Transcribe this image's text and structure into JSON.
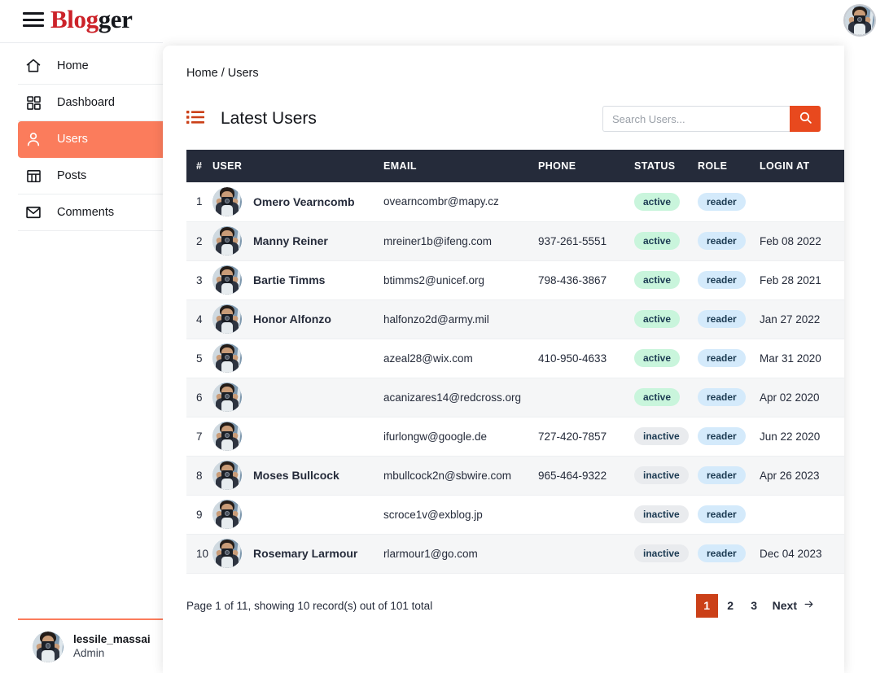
{
  "app": {
    "brand_red": "Blog",
    "brand_dark": "ger",
    "accent_orange": "#e8491e",
    "accent_salmon": "#fb7c5c",
    "header_dark": "#252b3a"
  },
  "topbar": {
    "menu_icon": "hamburger-menu-icon",
    "avatar_icon": "user-avatar"
  },
  "sidebar": {
    "items": [
      {
        "label": "Home",
        "icon": "home-icon",
        "active": false
      },
      {
        "label": "Dashboard",
        "icon": "grid-icon",
        "active": false
      },
      {
        "label": "Users",
        "icon": "user-icon",
        "active": true
      },
      {
        "label": "Posts",
        "icon": "table-icon",
        "active": false
      },
      {
        "label": "Comments",
        "icon": "envelope-icon",
        "active": false
      }
    ],
    "profile": {
      "name": "lessile_massai",
      "role": "Admin"
    }
  },
  "main": {
    "breadcrumb": "Home / Users",
    "section_title": "Latest Users",
    "section_icon": "list-icon",
    "search": {
      "placeholder": "Search Users...",
      "value": "",
      "button_icon": "search-icon"
    },
    "table": {
      "columns": [
        "#",
        "USER",
        "EMAIL",
        "PHONE",
        "STATUS",
        "ROLE",
        "LOGIN AT"
      ],
      "rows": [
        {
          "num": "1",
          "name": "Omero Vearncomb",
          "email": "ovearncombr@mapy.cz",
          "phone": "",
          "status": "active",
          "role": "reader",
          "login": ""
        },
        {
          "num": "2",
          "name": "Manny Reiner",
          "email": "mreiner1b@ifeng.com",
          "phone": "937-261-5551",
          "status": "active",
          "role": "reader",
          "login": "Feb 08 2022"
        },
        {
          "num": "3",
          "name": "Bartie Timms",
          "email": "btimms2@unicef.org",
          "phone": "798-436-3867",
          "status": "active",
          "role": "reader",
          "login": "Feb 28 2021"
        },
        {
          "num": "4",
          "name": "Honor Alfonzo",
          "email": "halfonzo2d@army.mil",
          "phone": "",
          "status": "active",
          "role": "reader",
          "login": "Jan 27 2022"
        },
        {
          "num": "5",
          "name": "",
          "email": "azeal28@wix.com",
          "phone": "410-950-4633",
          "status": "active",
          "role": "reader",
          "login": "Mar 31 2020"
        },
        {
          "num": "6",
          "name": "",
          "email": "acanizares14@redcross.org",
          "phone": "",
          "status": "active",
          "role": "reader",
          "login": "Apr 02 2020"
        },
        {
          "num": "7",
          "name": "",
          "email": "ifurlongw@google.de",
          "phone": "727-420-7857",
          "status": "inactive",
          "role": "reader",
          "login": "Jun 22 2020"
        },
        {
          "num": "8",
          "name": "Moses Bullcock",
          "email": "mbullcock2n@sbwire.com",
          "phone": "965-464-9322",
          "status": "inactive",
          "role": "reader",
          "login": "Apr 26 2023"
        },
        {
          "num": "9",
          "name": "",
          "email": "scroce1v@exblog.jp",
          "phone": "",
          "status": "inactive",
          "role": "reader",
          "login": ""
        },
        {
          "num": "10",
          "name": "Rosemary Larmour",
          "email": "rlarmour1@go.com",
          "phone": "",
          "status": "inactive",
          "role": "reader",
          "login": "Dec 04 2023"
        }
      ]
    },
    "pagination": {
      "info": "Page 1 of 11, showing 10 record(s) out of 101 total",
      "pages": [
        "1",
        "2",
        "3"
      ],
      "current": "1",
      "next_label": "Next",
      "next_icon": "arrow-right-icon"
    }
  }
}
